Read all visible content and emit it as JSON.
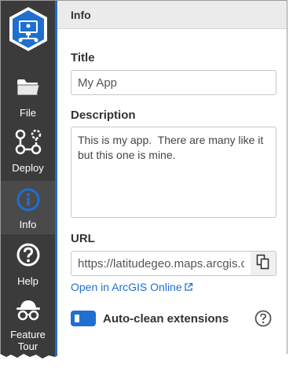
{
  "sidebar": {
    "items": [
      {
        "label": "File",
        "icon": "folder-icon"
      },
      {
        "label": "Deploy",
        "icon": "deploy-icon"
      },
      {
        "label": "Info",
        "icon": "info-icon",
        "active": true
      },
      {
        "label": "Help",
        "icon": "help-icon"
      },
      {
        "label": "Feature Tour",
        "icon": "spy-icon"
      }
    ],
    "accent_color": "#1e6fd0"
  },
  "header": {
    "title": "Info"
  },
  "form": {
    "title_label": "Title",
    "title_value": "My App",
    "description_label": "Description",
    "description_value": "This is my app.  There are many like it but this one is mine.",
    "url_label": "URL",
    "url_value": "https://latitudegeo.maps.arcgis.com",
    "open_link_label": "Open in ArcGIS Online",
    "toggle_label": "Auto-clean extensions",
    "toggle_on": true
  },
  "colors": {
    "sidebar_bg": "#3b3b3b",
    "link": "#1e6fd0",
    "header_bg": "#ebebeb"
  }
}
